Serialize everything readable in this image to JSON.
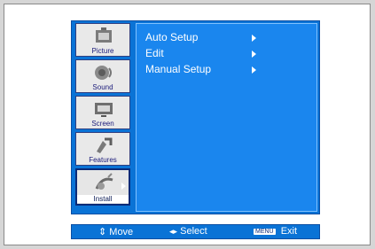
{
  "sidebar": {
    "items": [
      {
        "label": "Picture",
        "icon": "picture-icon"
      },
      {
        "label": "Sound",
        "icon": "sound-icon"
      },
      {
        "label": "Screen",
        "icon": "screen-icon"
      },
      {
        "label": "Features",
        "icon": "features-icon"
      },
      {
        "label": "Install",
        "icon": "install-icon",
        "active": true
      }
    ]
  },
  "menu": {
    "items": [
      {
        "label": "Auto Setup"
      },
      {
        "label": "Edit"
      },
      {
        "label": "Manual Setup"
      }
    ]
  },
  "footer": {
    "move_label": "Move",
    "select_label": "Select",
    "menu_badge": "MENU",
    "exit_label": "Exit"
  },
  "colors": {
    "osd_blue": "#0a73d6",
    "content_blue": "#1a86ee",
    "sidebar_bg": "#e9e9e9",
    "text": "#ffffff"
  }
}
